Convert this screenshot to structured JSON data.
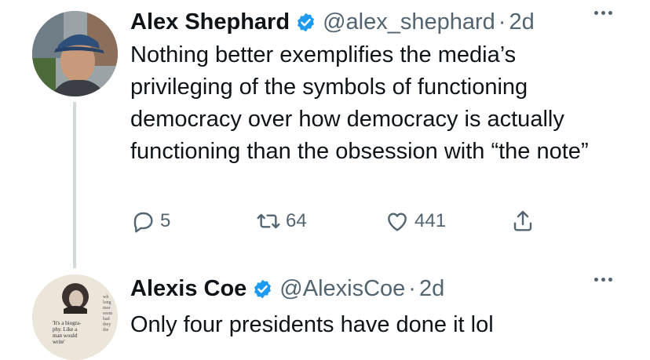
{
  "tweets": [
    {
      "name": "Alex Shephard",
      "handle": "@alex_shephard",
      "separator": "·",
      "time": "2d",
      "text": "Nothing better exemplifies the media’s privileging of the symbols of functioning democracy over how democracy is actually functioning than the obsession with “the note”",
      "replies": "5",
      "retweets": "64",
      "likes": "441"
    },
    {
      "name": "Alexis Coe",
      "handle": "@AlexisCoe",
      "separator": "·",
      "time": "2d",
      "text": "Only four presidents have done it lol",
      "book_clipping": {
        "quote": "It's a biography. Like a man would write",
        "side_text": "wh long mor seem had they the"
      }
    }
  ],
  "colors": {
    "verified": "#1d9bf0",
    "secondary_text": "#536471",
    "thread_line": "#cfd9de"
  },
  "icons": [
    "verified-badge-icon",
    "more-icon",
    "reply-icon",
    "retweet-icon",
    "like-icon",
    "share-icon"
  ]
}
